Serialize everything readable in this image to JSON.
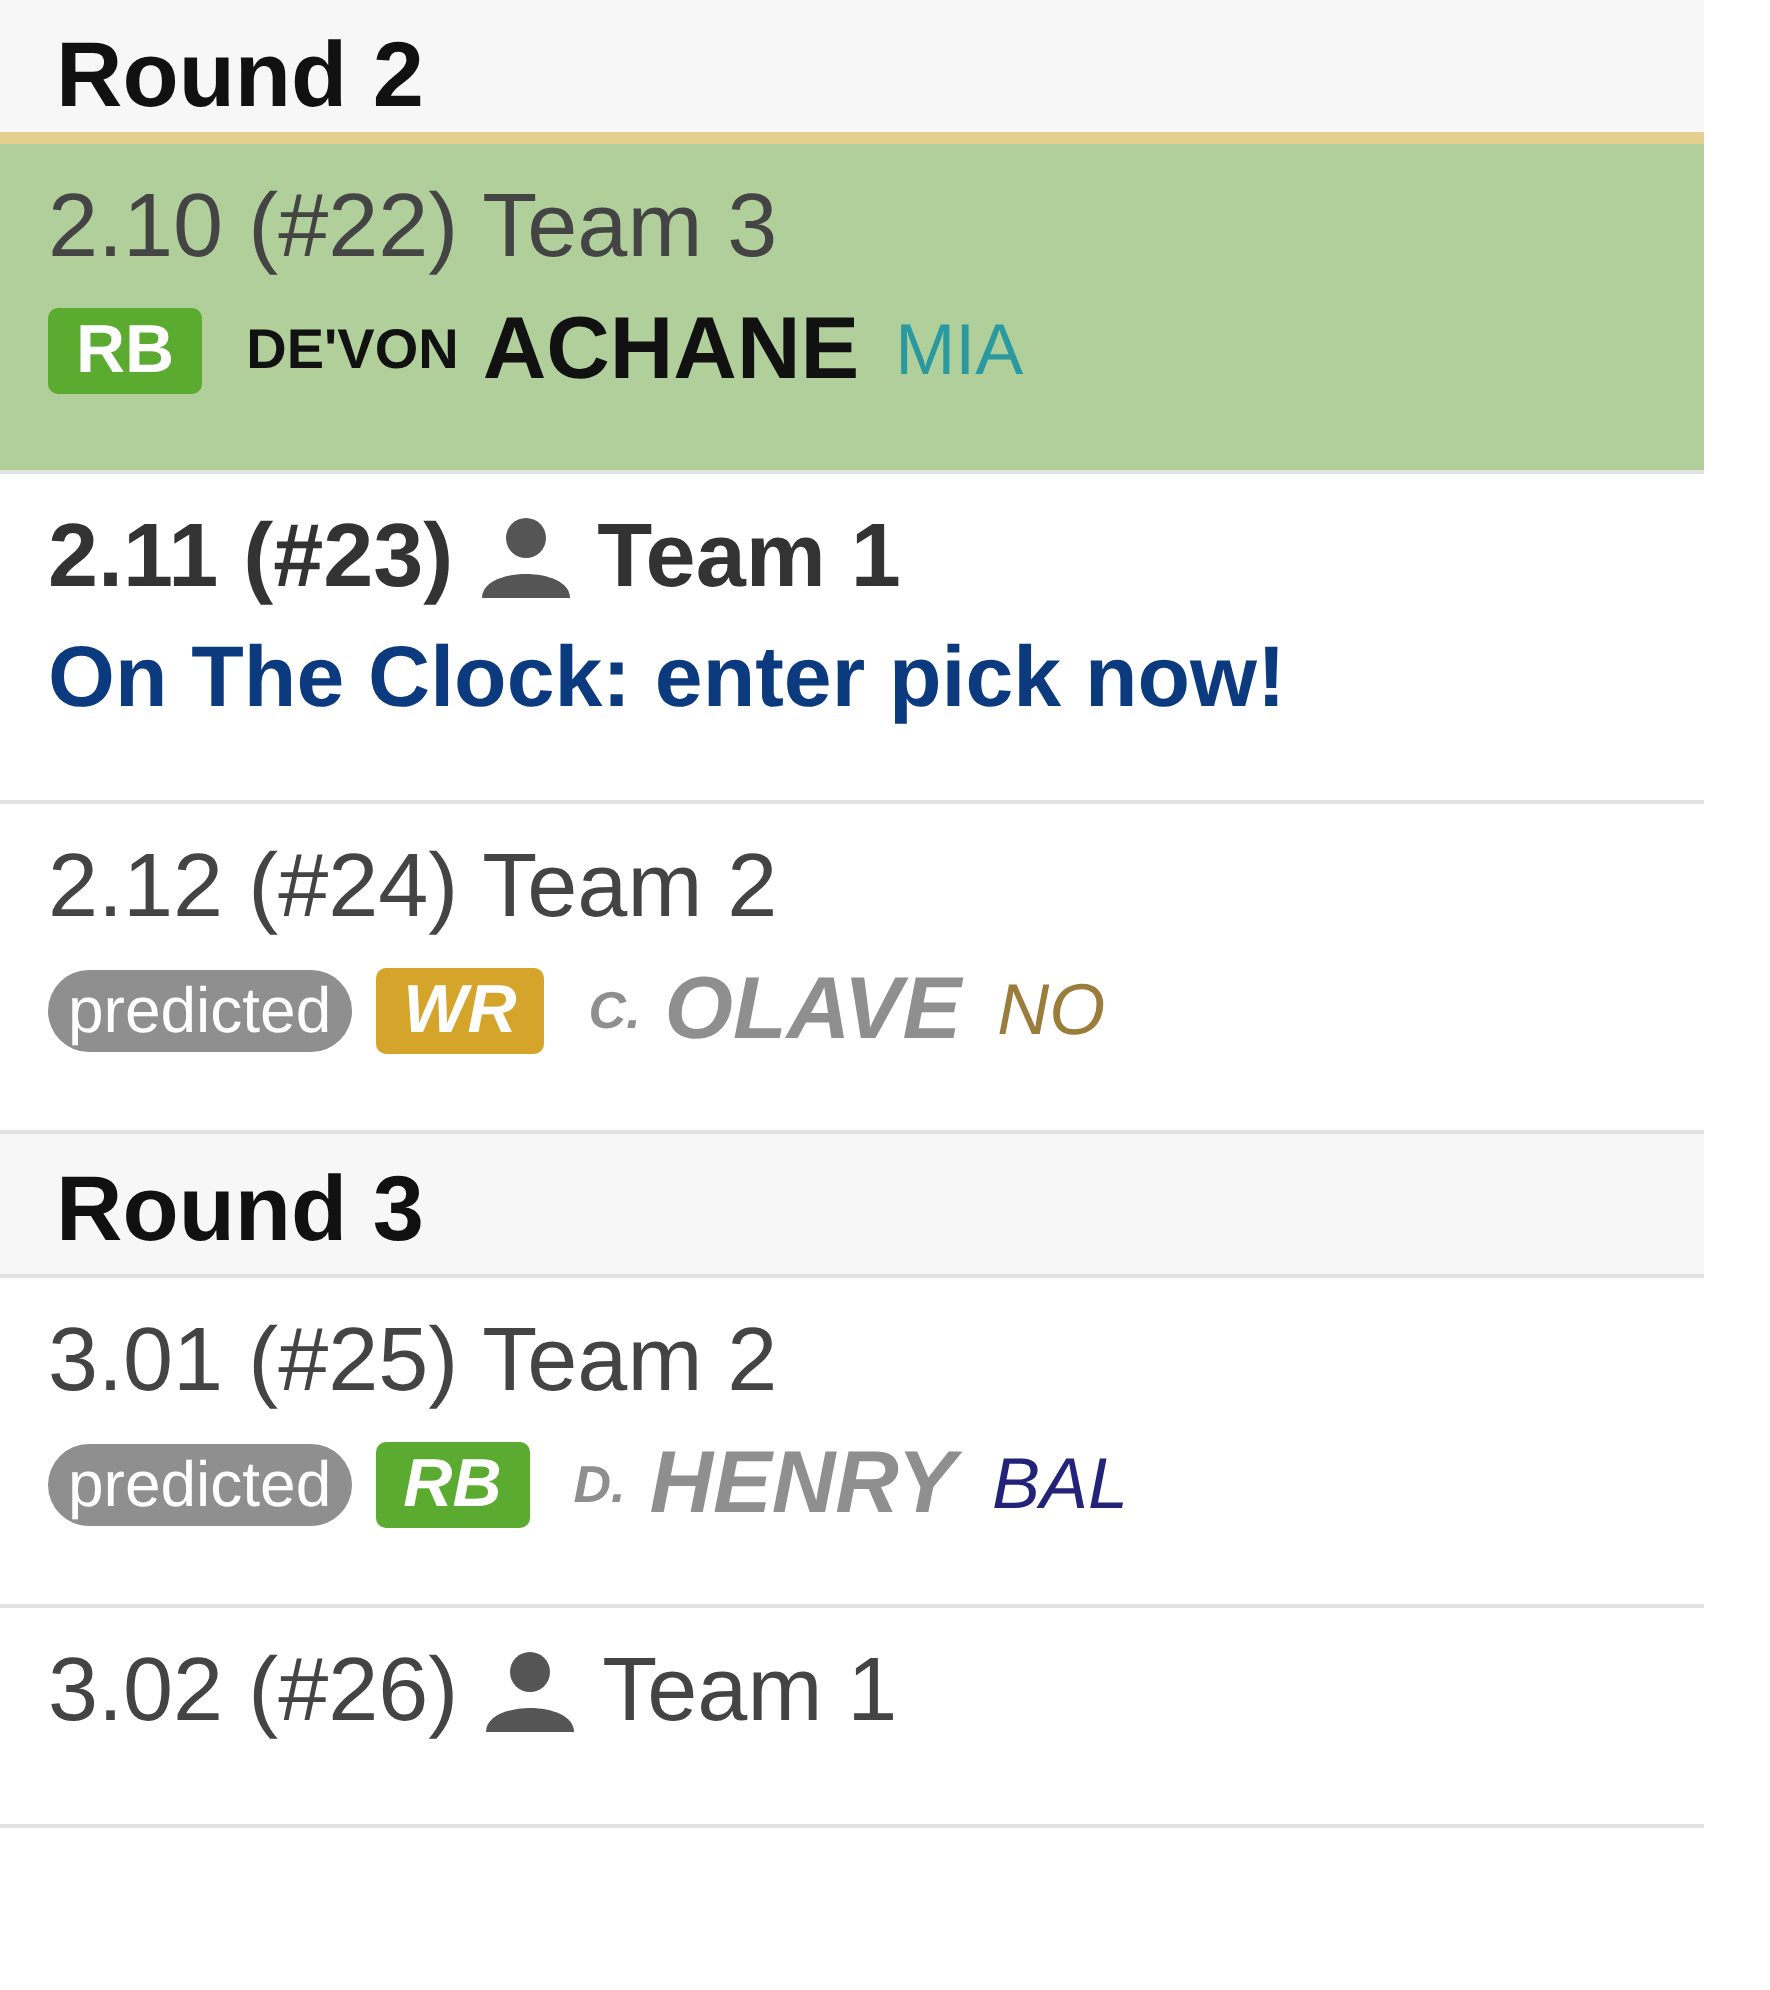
{
  "rounds": [
    {
      "title": "Round 2",
      "picks": [
        {
          "kind": "made",
          "slot": "2.10 (#22)",
          "team": "Team 3",
          "mine": false,
          "selected": true,
          "player": {
            "position": {
              "label": "RB",
              "color": "#5aab30"
            },
            "first": "DE'VON",
            "last": "ACHANE",
            "team": {
              "abbr": "MIA",
              "color": "#2a9aa0"
            }
          }
        },
        {
          "kind": "clock",
          "slot": "2.11 (#23)",
          "team": "Team 1",
          "mine": true,
          "selected": false,
          "message": "On The Clock: enter pick now!"
        },
        {
          "kind": "predicted",
          "slot": "2.12 (#24)",
          "team": "Team 2",
          "mine": false,
          "selected": false,
          "tag": "predicted",
          "player": {
            "position": {
              "label": "WR",
              "color": "#d4a52a"
            },
            "first": "C.",
            "last": "OLAVE",
            "team": {
              "abbr": "NO",
              "color": "#9a7d3a"
            }
          }
        }
      ]
    },
    {
      "title": "Round 3",
      "picks": [
        {
          "kind": "predicted",
          "slot": "3.01 (#25)",
          "team": "Team 2",
          "mine": false,
          "selected": false,
          "tag": "predicted",
          "player": {
            "position": {
              "label": "RB",
              "color": "#5aab30"
            },
            "first": "D.",
            "last": "HENRY",
            "team": {
              "abbr": "BAL",
              "color": "#24237a"
            }
          }
        },
        {
          "kind": "open",
          "slot": "3.02 (#26)",
          "team": "Team 1",
          "mine": true,
          "selected": false
        }
      ]
    }
  ]
}
